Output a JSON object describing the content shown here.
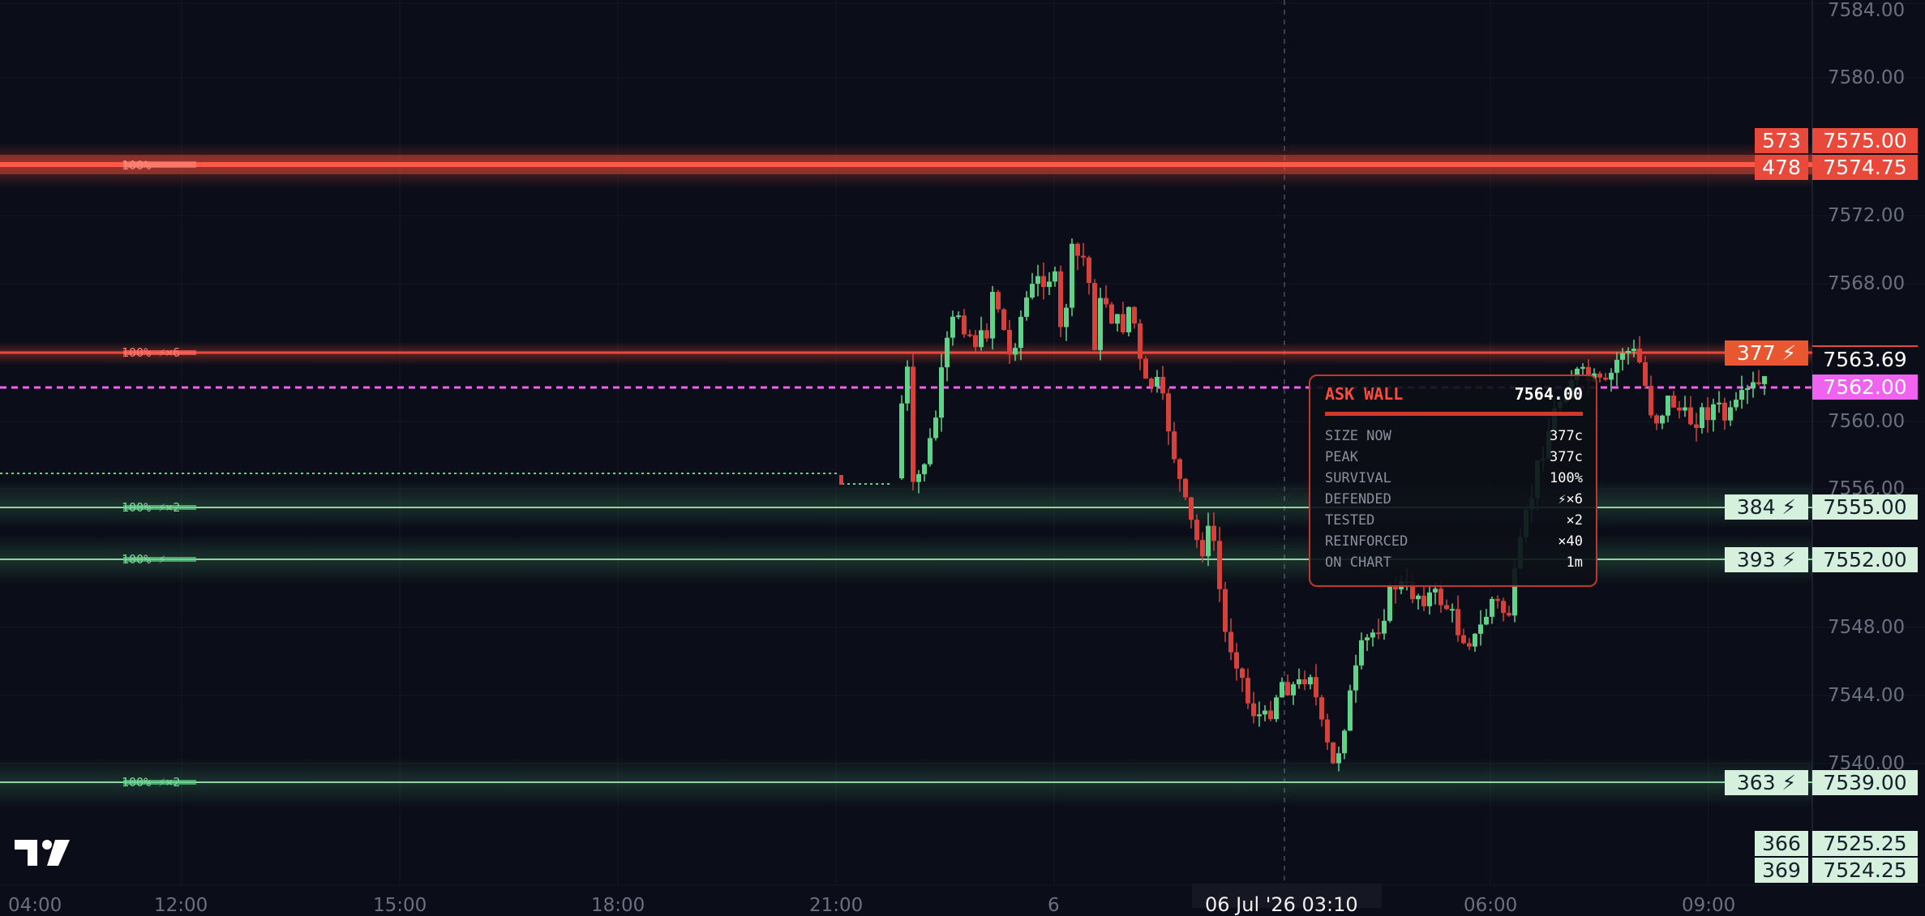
{
  "colors": {
    "background": "#0b0e18",
    "ask": "#e8493a",
    "bid": "#8fd4a2",
    "bull_candle": "#5fd38a",
    "bear_candle": "#d8413b",
    "magenta": "#f062f0"
  },
  "y_axis": {
    "ticks": [
      "7584.00",
      "7580.00",
      "7572.00",
      "7568.00",
      "7560.00",
      "7556.00",
      "7548.00",
      "7544.00",
      "7540.00"
    ]
  },
  "x_axis": {
    "ticks": [
      "04:00",
      "12:00",
      "15:00",
      "18:00",
      "21:00",
      "6",
      "06:00",
      "09:00"
    ],
    "crosshair_label": "06 Jul '26   03:10"
  },
  "price_labels": [
    {
      "size": "573",
      "price": "7575.00",
      "side": "ask"
    },
    {
      "size": "478",
      "price": "7574.75",
      "side": "ask"
    },
    {
      "size": "377 ⚡",
      "price": "",
      "side": "pending"
    },
    {
      "size": "",
      "price": "7563.69",
      "side": "current"
    },
    {
      "size": "",
      "price": "7562.00",
      "side": "magenta"
    },
    {
      "size": "384 ⚡",
      "price": "7555.00",
      "side": "bid"
    },
    {
      "size": "393 ⚡",
      "price": "7552.00",
      "side": "bid"
    },
    {
      "size": "363 ⚡",
      "price": "7539.00",
      "side": "bid"
    },
    {
      "size": "366",
      "price": "7525.25",
      "side": "bid"
    },
    {
      "size": "369",
      "price": "7524.25",
      "side": "bid"
    }
  ],
  "wall_badges": [
    {
      "text": "100%",
      "side": "ask"
    },
    {
      "text": "100% ⚡×6",
      "side": "ask"
    },
    {
      "text": "100% ⚡×2",
      "side": "bid"
    },
    {
      "text": "100% ⚡",
      "side": "bid"
    },
    {
      "text": "100% ⚡×2",
      "side": "bid"
    }
  ],
  "tooltip": {
    "title": "ASK WALL",
    "price": "7564.00",
    "rows": [
      {
        "label": "SIZE NOW",
        "value": "377c"
      },
      {
        "label": "PEAK",
        "value": "377c"
      },
      {
        "label": "SURVIVAL",
        "value": "100%"
      },
      {
        "label": "DEFENDED",
        "value": "⚡×6"
      },
      {
        "label": "TESTED",
        "value": "×2"
      },
      {
        "label": "REINFORCED",
        "value": "×40"
      },
      {
        "label": "ON CHART",
        "value": "1m"
      }
    ]
  },
  "logo": {
    "icon": "tradingview-logo-icon"
  }
}
